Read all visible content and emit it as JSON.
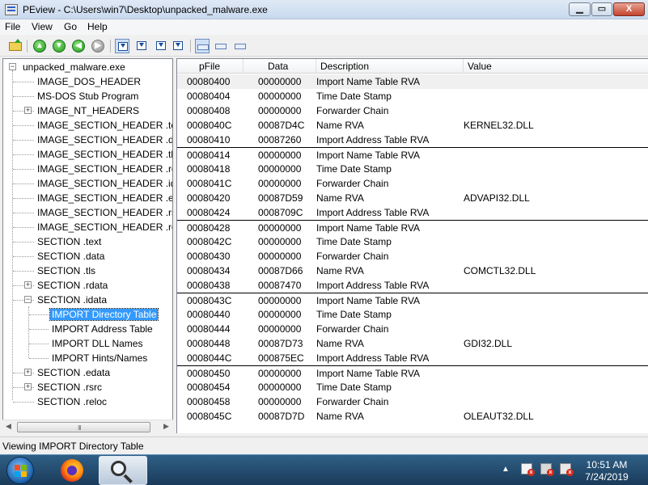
{
  "window": {
    "title": "PEview - C:\\Users\\win7\\Desktop\\unpacked_malware.exe",
    "minimize_glyph": "▁",
    "maximize_glyph": "▭",
    "close_glyph": "X"
  },
  "menu": {
    "items": [
      "File",
      "View",
      "Go",
      "Help"
    ]
  },
  "toolbar": {
    "back_glyph": "◀",
    "forward_glyph": "▶",
    "up_glyph": "▲",
    "down_glyph": "▼"
  },
  "tree": {
    "root": "unpacked_malware.exe",
    "items": [
      "IMAGE_DOS_HEADER",
      "MS-DOS Stub Program",
      "IMAGE_NT_HEADERS",
      "IMAGE_SECTION_HEADER .text",
      "IMAGE_SECTION_HEADER .data",
      "IMAGE_SECTION_HEADER .tls",
      "IMAGE_SECTION_HEADER .rdata",
      "IMAGE_SECTION_HEADER .idata",
      "IMAGE_SECTION_HEADER .edata",
      "IMAGE_SECTION_HEADER .rsrc",
      "IMAGE_SECTION_HEADER .reloc",
      "SECTION .text",
      "SECTION .data",
      "SECTION .tls",
      "SECTION .rdata",
      "SECTION .idata",
      "SECTION .edata",
      "SECTION .rsrc",
      "SECTION .reloc"
    ],
    "idata_children": [
      "IMPORT Directory Table",
      "IMPORT Address Table",
      "IMPORT DLL Names",
      "IMPORT Hints/Names"
    ],
    "selected": "IMPORT Directory Table",
    "expand_plus": "+",
    "expand_minus": "−"
  },
  "scrollbar": {
    "left_arrow": "◀",
    "right_arrow": "▶",
    "grip": "III"
  },
  "list": {
    "columns": [
      "pFile",
      "Data",
      "Description",
      "Value"
    ],
    "rows": [
      [
        "00080400",
        "00000000",
        "Import Name Table RVA",
        ""
      ],
      [
        "00080404",
        "00000000",
        "Time Date Stamp",
        ""
      ],
      [
        "00080408",
        "00000000",
        "Forwarder Chain",
        ""
      ],
      [
        "0008040C",
        "00087D4C",
        "Name RVA",
        "KERNEL32.DLL"
      ],
      [
        "00080410",
        "00087260",
        "Import Address Table RVA",
        ""
      ],
      [
        "00080414",
        "00000000",
        "Import Name Table RVA",
        ""
      ],
      [
        "00080418",
        "00000000",
        "Time Date Stamp",
        ""
      ],
      [
        "0008041C",
        "00000000",
        "Forwarder Chain",
        ""
      ],
      [
        "00080420",
        "00087D59",
        "Name RVA",
        "ADVAPI32.DLL"
      ],
      [
        "00080424",
        "0008709C",
        "Import Address Table RVA",
        ""
      ],
      [
        "00080428",
        "00000000",
        "Import Name Table RVA",
        ""
      ],
      [
        "0008042C",
        "00000000",
        "Time Date Stamp",
        ""
      ],
      [
        "00080430",
        "00000000",
        "Forwarder Chain",
        ""
      ],
      [
        "00080434",
        "00087D66",
        "Name RVA",
        "COMCTL32.DLL"
      ],
      [
        "00080438",
        "00087470",
        "Import Address Table RVA",
        ""
      ],
      [
        "0008043C",
        "00000000",
        "Import Name Table RVA",
        ""
      ],
      [
        "00080440",
        "00000000",
        "Time Date Stamp",
        ""
      ],
      [
        "00080444",
        "00000000",
        "Forwarder Chain",
        ""
      ],
      [
        "00080448",
        "00087D73",
        "Name RVA",
        "GDI32.DLL"
      ],
      [
        "0008044C",
        "000875EC",
        "Import Address Table RVA",
        ""
      ],
      [
        "00080450",
        "00000000",
        "Import Name Table RVA",
        ""
      ],
      [
        "00080454",
        "00000000",
        "Time Date Stamp",
        ""
      ],
      [
        "00080458",
        "00000000",
        "Forwarder Chain",
        ""
      ],
      [
        "0008045C",
        "00087D7D",
        "Name RVA",
        "OLEAUT32.DLL"
      ]
    ]
  },
  "status": {
    "text": "Viewing IMPORT Directory Table"
  },
  "taskbar": {
    "tray_chevron": "▲",
    "time": "10:51 AM",
    "date": "7/24/2019",
    "tray_x": "x"
  }
}
